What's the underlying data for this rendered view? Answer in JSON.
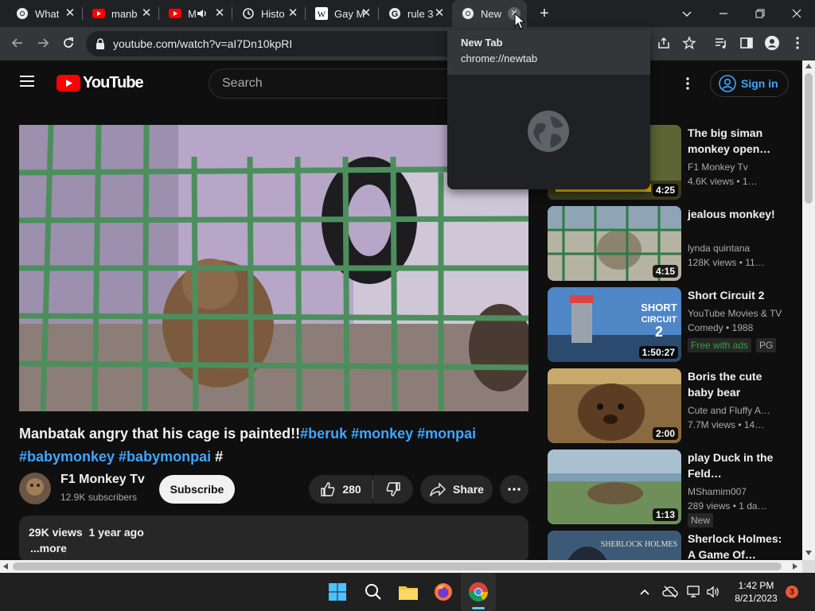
{
  "browser": {
    "tabs": [
      {
        "title": "What",
        "icon": "chrome-icon"
      },
      {
        "title": "manb",
        "icon": "youtube-icon"
      },
      {
        "title": "M",
        "icon": "youtube-icon",
        "muted_audio": true
      },
      {
        "title": "Histo",
        "icon": "history-icon"
      },
      {
        "title": "Gay M",
        "icon": "wikipedia-icon"
      },
      {
        "title": "rule 3",
        "icon": "google-icon"
      },
      {
        "title": "New",
        "icon": "chrome-icon",
        "active": true
      }
    ],
    "new_tab_symbol": "+",
    "url": "youtube.com/watch?v=aI7Dn10kpRI",
    "hover_card": {
      "title": "New Tab",
      "url": "chrome://newtab"
    }
  },
  "youtube": {
    "logo_text": "YouTube",
    "search_placeholder": "Search",
    "sign_in_label": "Sign in",
    "video": {
      "title_text": "Manbatak angry that his cage is painted!!",
      "hashtags_line1": "#beruk #monkey #monpai",
      "hashtags_line2": "#babymonkey #babymonpai",
      "trailing_hash": "#",
      "channel": "F1 Monkey Tv",
      "subscribers": "12.9K subscribers",
      "subscribe_label": "Subscribe",
      "likes": "280",
      "share_label": "Share",
      "views_date": "29K views  1 year ago",
      "more_label": "...more"
    },
    "recommendations": [
      {
        "title": "The big siman monkey open…",
        "channel": "F1 Monkey Tv",
        "meta": "4.6K views  • 1…",
        "duration": "4:25",
        "thumb_color": "#6a6f3c"
      },
      {
        "title": "jealous monkey!",
        "channel": "lynda quintana",
        "meta": "128K views  • 11…",
        "duration": "4:15",
        "thumb_color": "#8a8f7a"
      },
      {
        "title": "Short Circuit 2",
        "channel": "YouTube Movies & TV",
        "meta": "Comedy • 1988",
        "duration": "1:50:27",
        "badge": "Free with ads",
        "badge2": "PG",
        "thumb_color": "#3a6ea5"
      },
      {
        "title": "Boris the cute baby bear",
        "channel": "Cute and Fluffy A…",
        "meta": "7.7M views  • 14…",
        "duration": "2:00",
        "thumb_color": "#7a5a35"
      },
      {
        "title": "play Duck in the Feld…",
        "channel": "MShamim007",
        "meta": "289 views  • 1 da…",
        "duration": "1:13",
        "badge": "New",
        "thumb_color": "#7f9a6a"
      },
      {
        "title": "Sherlock Holmes: A Game Of…",
        "channel": "",
        "meta": "",
        "duration": "",
        "thumb_color": "#3c5a78",
        "thumb_text": "SHERLOCK HOLMES"
      }
    ]
  },
  "taskbar": {
    "time": "1:42 PM",
    "date": "8/21/2023",
    "notification_count": "3"
  },
  "colors": {
    "accent_blue": "#3ea6ff",
    "youtube_red": "#ff0000",
    "chrome_bar": "#202124",
    "toolbar": "#35363a"
  }
}
